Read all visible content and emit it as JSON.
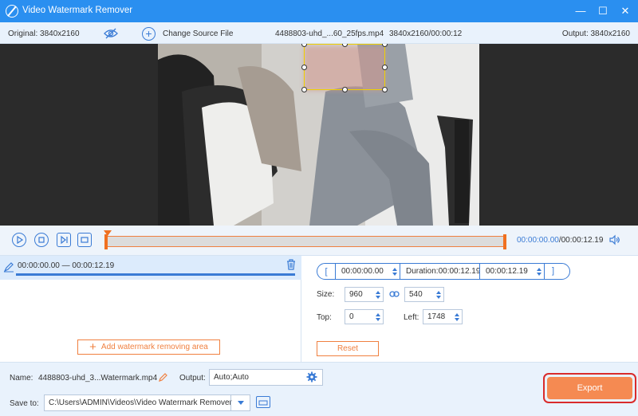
{
  "app": {
    "title": "Video Watermark Remover"
  },
  "window_controls": {
    "minimize": "—",
    "maximize": "☐",
    "close": "✕"
  },
  "info": {
    "original": "Original: 3840x2160",
    "change_source": "Change Source File",
    "file_name": "4488803-uhd_...60_25fps.mp4",
    "file_meta": "3840x2160/00:00:12",
    "output": "Output: 3840x2160"
  },
  "playback": {
    "current_time": "00:00:00.00",
    "total_time": "/00:00:12.19"
  },
  "segments": [
    {
      "range": "00:00:00.00 — 00:00:12.19"
    }
  ],
  "add_watermark_label": "Add watermark removing area",
  "area": {
    "start": "00:00:00.00",
    "duration": "Duration:00:00:12.19",
    "end": "00:00:12.19",
    "open_bracket": "[",
    "close_bracket": "]",
    "size_label": "Size:",
    "width": "960",
    "height": "540",
    "top_label": "Top:",
    "top": "0",
    "left_label": "Left:",
    "left": "1748",
    "reset_label": "Reset"
  },
  "output_settings": {
    "name_label": "Name:",
    "name_value": "4488803-uhd_3...Watermark.mp4",
    "output_label": "Output:",
    "output_value": "Auto;Auto",
    "save_label": "Save to:",
    "save_path": "C:\\Users\\ADMIN\\Videos\\Video Watermark Remover",
    "export_label": "Export"
  },
  "colors": {
    "accent": "#2a8ff0",
    "export": "#f58a52",
    "orange": "#f08040"
  }
}
